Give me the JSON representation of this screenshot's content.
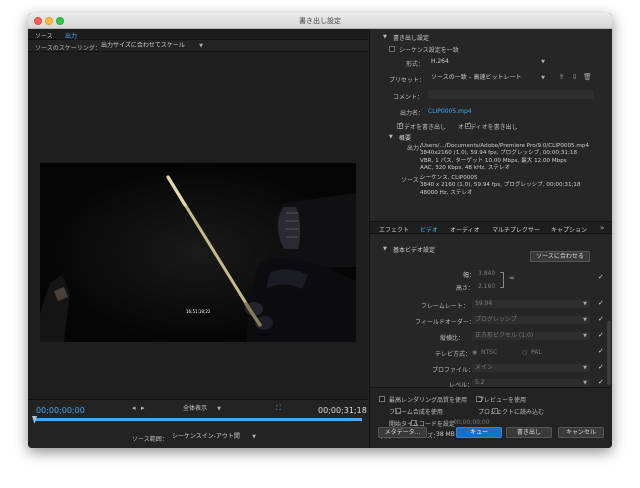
{
  "window": {
    "title": "書き出し設定"
  },
  "left": {
    "tabs": [
      "ソース",
      "出力"
    ],
    "scaling_label": "ソースのスケーリング：",
    "scaling_value": "出力サイズに合わせてスケール",
    "overlay_timecode": "16;51;18;22",
    "time_current": "00;00;00;00",
    "zoom_value": "全体表示",
    "time_end": "00;00;31;18",
    "source_range_label": "ソース範囲：",
    "source_range_value": "シーケンスイン-アウト間"
  },
  "export": {
    "section_title": "書き出し設定",
    "match_sequence": "シーケンス設定を一致",
    "format_label": "形式：",
    "format_value": "H.264",
    "preset_label": "プリセット：",
    "preset_value": "ソースの一致 – 高速ビットレート",
    "comment_label": "コメント：",
    "output_name_label": "出力名：",
    "output_name_value": "CLIP0005.mp4",
    "export_video": "ビデオを書き出し",
    "export_audio": "オーディオを書き出し",
    "summary_title": "概要",
    "output_label": "出力：",
    "output_lines": [
      "/Users/.../Documents/Adobe/Premiere Pro/9.0/CLIP0005.mp4",
      "3840x2160 (1.0), 59.94 fps, プログレッシブ, 00;00;31;18",
      "VBR, 1 パス, ターゲット 10.00 Mbps, 最大 12.00 Mbps",
      "AAC, 320 Kbps, 48 kHz, ステレオ"
    ],
    "source_label": "ソース：",
    "source_lines": [
      "シーケンス, CLIP0005",
      "3840 x 2160 (1.0), 59.94 fps, プログレッシブ, 00;00;31;18",
      "48000 Hz, ステレオ"
    ]
  },
  "settings_tabs": [
    "エフェクト",
    "ビデオ",
    "オーディオ",
    "マルチプレクサー",
    "キャプション"
  ],
  "video": {
    "section_title": "基本ビデオ設定",
    "match_source_button": "ソースに合わせる",
    "width_label": "幅：",
    "width_value": "3,840",
    "height_label": "高さ：",
    "height_value": "2,160",
    "rows": [
      {
        "label": "フレームレート：",
        "value": "59.94"
      },
      {
        "label": "フィールドオーダー：",
        "value": "プログレッシブ"
      },
      {
        "label": "縦横比：",
        "value": "正方形ピクセル (1.0)"
      }
    ],
    "tv_label": "テレビ方式：",
    "tv_ntsc": "NTSC",
    "tv_pal": "PAL",
    "profile_label": "プロファイル：",
    "profile_value": "メイン",
    "level_label": "レベル：",
    "level_value": "5.2"
  },
  "bottom": {
    "max_render": "最高レンダリング品質を使用",
    "use_preview": "プレビューを使用",
    "frame_blend": "フレーム合成を使用",
    "import_project": "プロジェクトに読み込む",
    "start_timecode": "開始タイムコードを設定",
    "start_timecode_value": "00;00;00;00",
    "file_size_label": "予測ファイルサイズ：",
    "file_size_value": "38 MB",
    "metadata_button": "メタデータ...",
    "queue_button": "キュー",
    "export_button": "書き出し",
    "cancel_button": "キャンセル"
  }
}
